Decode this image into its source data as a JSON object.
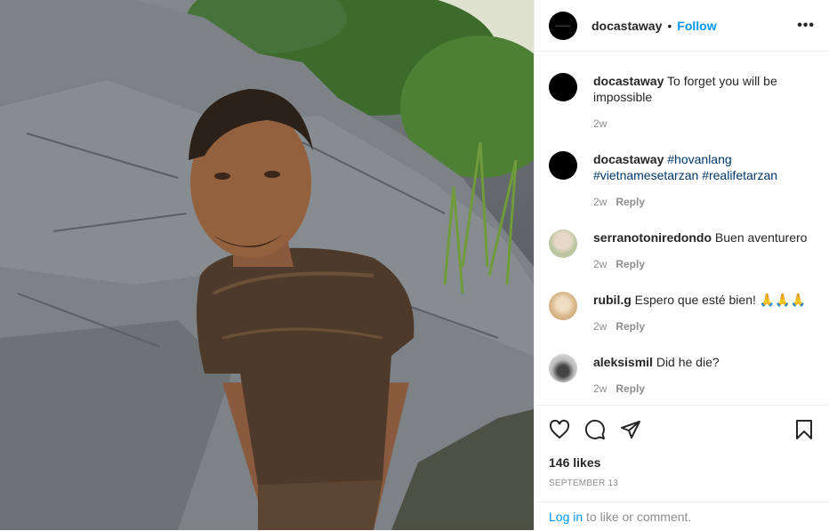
{
  "header": {
    "username": "docastaway",
    "separator": "•",
    "follow_label": "Follow",
    "more_icon": "more-options-icon"
  },
  "comments": [
    {
      "username": "docastaway",
      "text": "To forget you will be impossible",
      "hashtags": [],
      "time": "2w",
      "reply_label": "",
      "avatar": "black-logo"
    },
    {
      "username": "docastaway",
      "text": "",
      "hashtags": [
        "#hovanlang",
        "#vietnamesetarzan",
        "#realifetarzan"
      ],
      "time": "2w",
      "reply_label": "Reply",
      "avatar": "black-logo"
    },
    {
      "username": "serranotoniredondo",
      "text": "Buen aventurero",
      "hashtags": [],
      "time": "2w",
      "reply_label": "Reply",
      "avatar": "photo"
    },
    {
      "username": "rubil.g",
      "text": "Espero que esté bien! 🙏🙏🙏",
      "hashtags": [],
      "time": "2w",
      "reply_label": "Reply",
      "avatar": "photo"
    },
    {
      "username": "aleksismil",
      "text": "Did he die?",
      "hashtags": [],
      "time": "2w",
      "reply_label": "Reply",
      "avatar": "photo"
    }
  ],
  "actions": {
    "like_icon": "heart-icon",
    "comment_icon": "comment-icon",
    "share_icon": "share-icon",
    "save_icon": "bookmark-icon"
  },
  "likes": "146 likes",
  "date": "SEPTEMBER 13",
  "footer": {
    "login_label": "Log in",
    "rest": " to like or comment."
  },
  "colors": {
    "link": "#0095f6",
    "hashtag": "#00376b",
    "muted": "#8e8e8e",
    "text": "#262626"
  }
}
